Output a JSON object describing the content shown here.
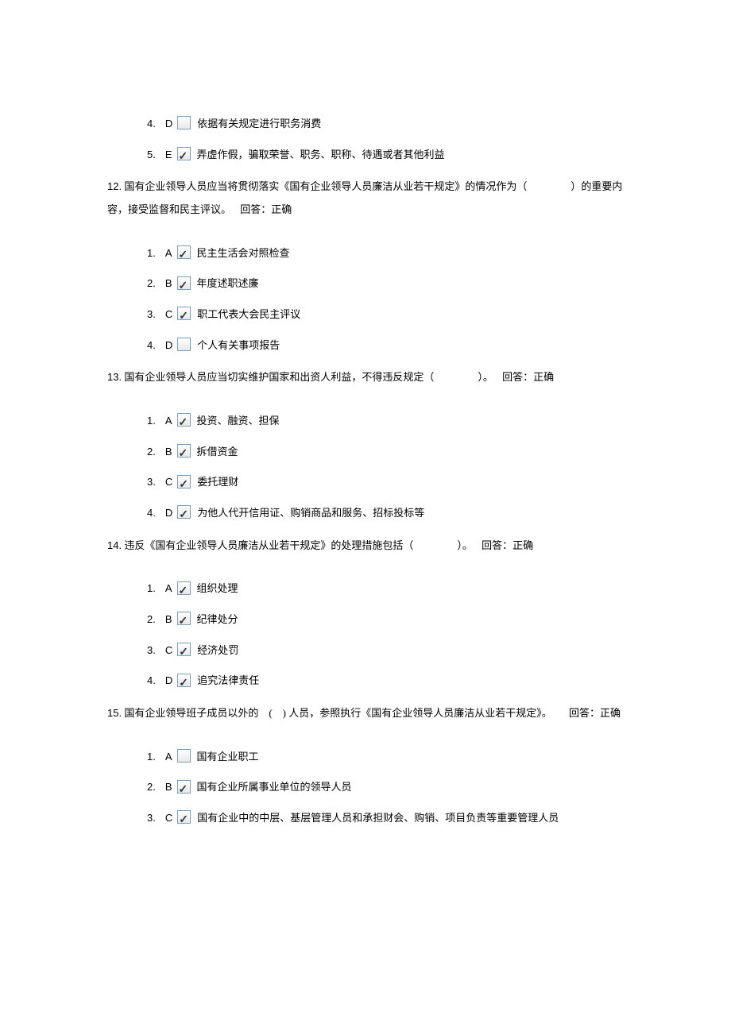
{
  "stray_options": [
    {
      "num": "4.",
      "letter": "D",
      "checked": false,
      "text": "依据有关规定进行职务消费"
    },
    {
      "num": "5.",
      "letter": "E",
      "checked": true,
      "text": "弄虚作假，骗取荣誉、职务、职称、待遇或者其他利益"
    }
  ],
  "questions": [
    {
      "num": "12.",
      "text_pre": "国有企业领导人员应当将贯彻落实《国有企业领导人员廉洁从业若干规定》的情况作为（",
      "text_post": "）的重要内容，接受监督和民主评议。",
      "answer_label": "回答：正确",
      "answer_inline_after_post": true,
      "options": [
        {
          "num": "1.",
          "letter": "A",
          "checked": true,
          "text": "民主生活会对照检查"
        },
        {
          "num": "2.",
          "letter": "B",
          "checked": true,
          "text": "年度述职述廉"
        },
        {
          "num": "3.",
          "letter": "C",
          "checked": true,
          "text": "职工代表大会民主评议"
        },
        {
          "num": "4.",
          "letter": "D",
          "checked": false,
          "text": "个人有关事项报告"
        }
      ]
    },
    {
      "num": "13.",
      "text_pre": "国有企业领导人员应当切实维护国家和出资人利益，不得违反规定（",
      "text_post": "）。",
      "answer_label": "回答：正确",
      "answer_inline_after_post": false,
      "options": [
        {
          "num": "1.",
          "letter": "A",
          "checked": true,
          "text": "投资、融资、担保"
        },
        {
          "num": "2.",
          "letter": "B",
          "checked": true,
          "text": "拆借资金"
        },
        {
          "num": "3.",
          "letter": "C",
          "checked": true,
          "text": "委托理财"
        },
        {
          "num": "4.",
          "letter": "D",
          "checked": true,
          "text": "为他人代开信用证、购销商品和服务、招标投标等"
        }
      ]
    },
    {
      "num": "14.",
      "text_pre": "违反《国有企业领导人员廉洁从业若干规定》的处理措施包括（",
      "text_post": "）。",
      "answer_label": "回答：正确",
      "answer_inline_after_post": false,
      "options": [
        {
          "num": "1.",
          "letter": "A",
          "checked": true,
          "text": "组织处理"
        },
        {
          "num": "2.",
          "letter": "B",
          "checked": true,
          "text": "纪律处分"
        },
        {
          "num": "3.",
          "letter": "C",
          "checked": true,
          "text": "经济处罚"
        },
        {
          "num": "4.",
          "letter": "D",
          "checked": true,
          "text": "追究法律责任"
        }
      ]
    },
    {
      "num": "15.",
      "text_pre": "国有企业领导班子成员以外的　(　) 人员，参照执行《国有企业领导人员廉洁从业若干规定》。",
      "text_post": "",
      "answer_label": "回答：正确",
      "answer_inline_after_post": false,
      "options": [
        {
          "num": "1.",
          "letter": "A",
          "checked": false,
          "text": "国有企业职工"
        },
        {
          "num": "2.",
          "letter": "B",
          "checked": true,
          "text": "国有企业所属事业单位的领导人员"
        },
        {
          "num": "3.",
          "letter": "C",
          "checked": true,
          "text": "国有企业中的中层、基层管理人员和承担财会、购销、项目负责等重要管理人员"
        }
      ]
    }
  ]
}
